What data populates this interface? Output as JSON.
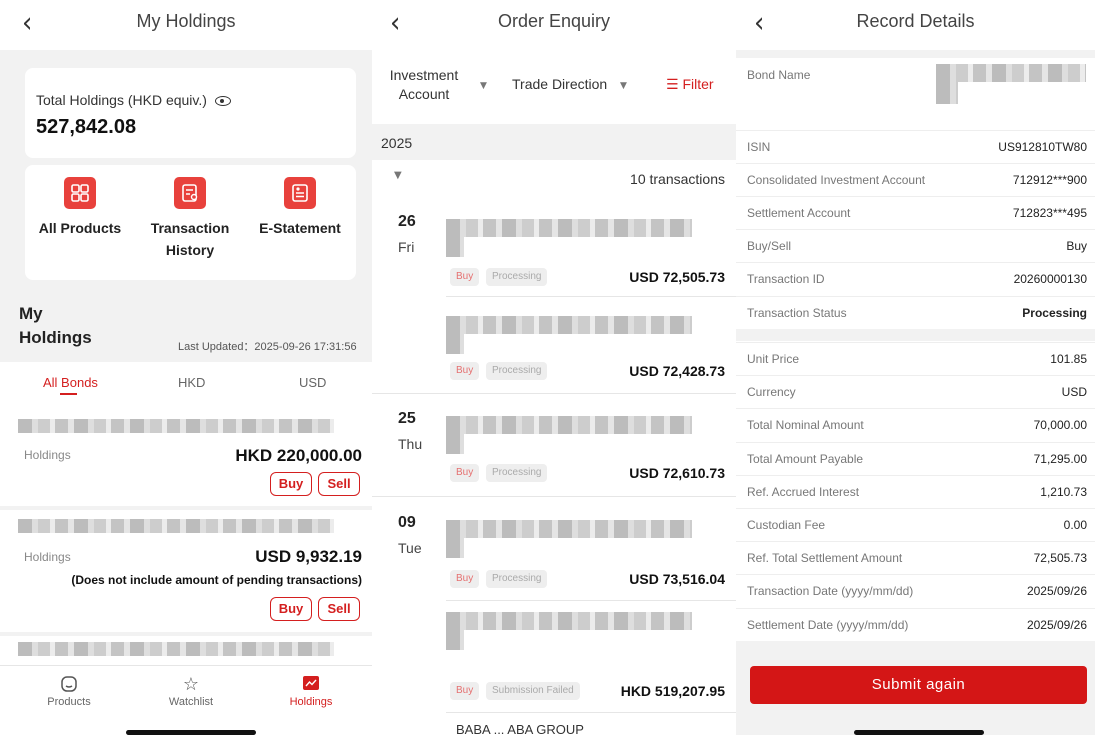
{
  "holdings_screen": {
    "title": "My Holdings",
    "total_label": "Total Holdings (HKD equiv.)",
    "total_value": "527,842.08",
    "actions": [
      {
        "label": "All Products",
        "icon": "grid-icon"
      },
      {
        "label": "Transaction History",
        "icon": "search-document-icon"
      },
      {
        "label": "E-Statement",
        "icon": "statement-icon"
      }
    ],
    "section_title": "My Holdings",
    "last_updated": "Last Updated：2025-09-26 17:31:56",
    "tabs": [
      "All Bonds",
      "HKD",
      "USD"
    ],
    "items": [
      {
        "label": "Holdings",
        "value": "HKD 220,000.00",
        "note": "",
        "buy": "Buy",
        "sell": "Sell"
      },
      {
        "label": "Holdings",
        "value": "USD 9,932.19",
        "note": "(Does not include amount of pending transactions)",
        "buy": "Buy",
        "sell": "Sell"
      }
    ],
    "tabbar": [
      {
        "label": "Products",
        "icon": "home-icon"
      },
      {
        "label": "Watchlist",
        "icon": "star-icon"
      },
      {
        "label": "Holdings",
        "icon": "chart-icon"
      }
    ]
  },
  "orders_screen": {
    "title": "Order Enquiry",
    "filter_account": "Investment Account",
    "filter_direction": "Trade Direction",
    "filter_label": "Filter",
    "year": "2025",
    "tx_count": "10 transactions",
    "days": [
      {
        "day": "26",
        "weekday": "Fri"
      },
      {
        "day": "25",
        "weekday": "Thu"
      },
      {
        "day": "09",
        "weekday": "Tue"
      }
    ],
    "orders": [
      {
        "side": "Buy",
        "status": "Processing",
        "amount": "USD 72,505.73"
      },
      {
        "side": "Buy",
        "status": "Processing",
        "amount": "USD 72,428.73"
      },
      {
        "side": "Buy",
        "status": "Processing",
        "amount": "USD 72,610.73"
      },
      {
        "side": "Buy",
        "status": "Processing",
        "amount": "USD 73,516.04"
      },
      {
        "side": "Buy",
        "status": "Submission Failed",
        "amount": "HKD 519,207.95"
      }
    ],
    "truncated_name": "BABA ... ABA GROUP"
  },
  "record_screen": {
    "title": "Record Details",
    "bond_name_label": "Bond Name",
    "rows": [
      {
        "label": "ISIN",
        "value": "US912810TW80"
      },
      {
        "label": "Consolidated Investment Account",
        "value": "712912***900"
      },
      {
        "label": "Settlement Account",
        "value": "712823***495"
      },
      {
        "label": "Buy/Sell",
        "value": "Buy"
      },
      {
        "label": "Transaction ID",
        "value": "20260000130"
      },
      {
        "label": "Transaction Status",
        "value": "Processing"
      },
      {
        "label": "Unit Price",
        "value": "101.85"
      },
      {
        "label": "Currency",
        "value": "USD"
      },
      {
        "label": "Total Nominal Amount",
        "value": "70,000.00"
      },
      {
        "label": "Total Amount Payable",
        "value": "71,295.00"
      },
      {
        "label": "Ref. Accrued Interest",
        "value": "1,210.73"
      },
      {
        "label": "Custodian Fee",
        "value": "0.00"
      },
      {
        "label": "Ref. Total Settlement Amount",
        "value": "72,505.73"
      },
      {
        "label": "Transaction Date (yyyy/mm/dd)",
        "value": "2025/09/26"
      },
      {
        "label": "Settlement Date (yyyy/mm/dd)",
        "value": "2025/09/26"
      }
    ],
    "submit_label": "Submit again"
  },
  "colors": {
    "accent": "#d41f1f",
    "background": "#f2f2f2",
    "icon_red": "#e8413c"
  }
}
